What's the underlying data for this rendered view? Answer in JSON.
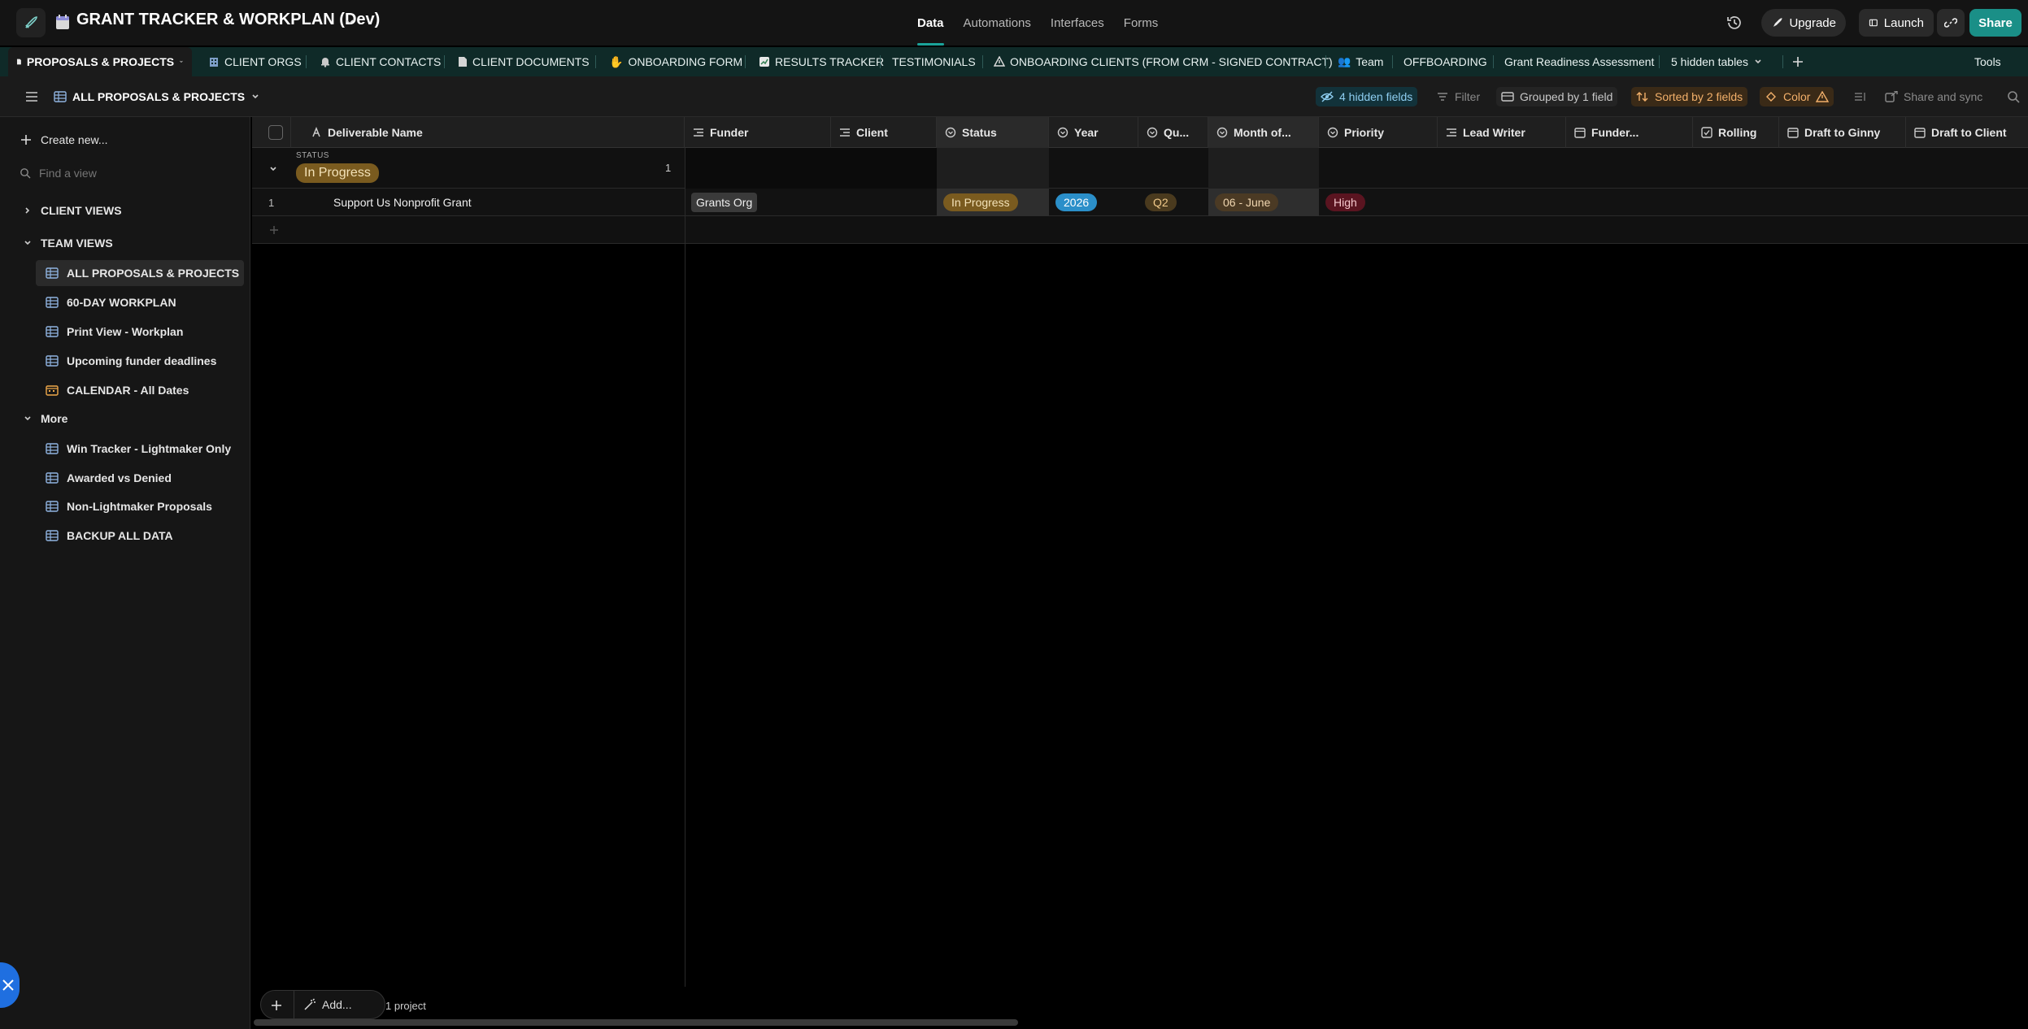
{
  "app": {
    "base_title": "GRANT TRACKER & WORKPLAN (Dev)",
    "nav": [
      {
        "label": "Data",
        "active": true
      },
      {
        "label": "Automations",
        "active": false
      },
      {
        "label": "Interfaces",
        "active": false
      },
      {
        "label": "Forms",
        "active": false
      }
    ],
    "actions": {
      "upgrade": "Upgrade",
      "launch": "Launch",
      "share": "Share"
    }
  },
  "tables": {
    "active": "PROPOSALS & PROJECTS",
    "items": [
      {
        "label": "CLIENT ORGS",
        "icon": "building-icon"
      },
      {
        "label": "CLIENT CONTACTS",
        "icon": "bell-icon"
      },
      {
        "label": "CLIENT DOCUMENTS",
        "icon": "document-icon"
      },
      {
        "label": "ONBOARDING FORM",
        "icon": "wave-hand-icon"
      },
      {
        "label": "RESULTS TRACKER",
        "icon": "chart-icon"
      },
      {
        "label": "TESTIMONIALS",
        "icon": ""
      },
      {
        "label": "ONBOARDING CLIENTS (FROM CRM - SIGNED CONTRACT)",
        "icon": "warning-icon"
      },
      {
        "label": "Team",
        "icon": "people-icon"
      },
      {
        "label": "OFFBOARDING",
        "icon": ""
      },
      {
        "label": "Grant Readiness Assessment",
        "icon": ""
      }
    ],
    "hidden": "5 hidden tables",
    "tools": "Tools"
  },
  "viewbar": {
    "view_name": "ALL PROPOSALS & PROJECTS",
    "hidden_fields": "4 hidden fields",
    "filter": "Filter",
    "grouped": "Grouped by 1 field",
    "sorted": "Sorted by 2 fields",
    "color": "Color",
    "share_sync": "Share and sync"
  },
  "sidebar": {
    "create_new": "Create new...",
    "find_view_placeholder": "Find a view",
    "sections": {
      "client_views": "CLIENT VIEWS",
      "team_views": "TEAM VIEWS",
      "more": "More"
    },
    "team_views": [
      {
        "label": "ALL PROPOSALS & PROJECTS",
        "icon": "grid-icon",
        "active": true
      },
      {
        "label": "60-DAY WORKPLAN",
        "icon": "grid-icon"
      },
      {
        "label": "Print View - Workplan",
        "icon": "grid-icon"
      },
      {
        "label": "Upcoming funder deadlines",
        "icon": "grid-icon"
      },
      {
        "label": "CALENDAR - All Dates",
        "icon": "calendar-icon"
      }
    ],
    "more_views": [
      {
        "label": "Win Tracker - Lightmaker Only",
        "icon": "grid-icon"
      },
      {
        "label": "Awarded vs Denied",
        "icon": "grid-icon"
      },
      {
        "label": "Non-Lightmaker Proposals",
        "icon": "grid-icon"
      },
      {
        "label": "BACKUP ALL DATA",
        "icon": "grid-icon"
      }
    ]
  },
  "grid": {
    "columns": [
      {
        "label": "Deliverable Name",
        "icon": "text-icon"
      },
      {
        "label": "Funder",
        "icon": "link-icon"
      },
      {
        "label": "Client",
        "icon": "link-icon"
      },
      {
        "label": "Status",
        "icon": "single-select-icon"
      },
      {
        "label": "Year",
        "icon": "single-select-icon"
      },
      {
        "label": "Qu...",
        "icon": "single-select-icon"
      },
      {
        "label": "Month of...",
        "icon": "single-select-icon"
      },
      {
        "label": "Priority",
        "icon": "single-select-icon"
      },
      {
        "label": "Lead Writer",
        "icon": "link-icon"
      },
      {
        "label": "Funder...",
        "icon": "date-icon"
      },
      {
        "label": "Rolling",
        "icon": "checkbox-icon"
      },
      {
        "label": "Draft to Ginny",
        "icon": "date-icon"
      },
      {
        "label": "Draft to Client",
        "icon": "date-icon"
      }
    ],
    "group": {
      "field_label": "STATUS",
      "value": "In Progress",
      "count": "1"
    },
    "rows": [
      {
        "num": "1",
        "deliverable": "Support Us Nonprofit Grant",
        "funder": "Grants Org",
        "status": "In Progress",
        "year": "2026",
        "quarter": "Q2",
        "month": "06 - June",
        "priority": "High"
      }
    ],
    "footer": {
      "add_label": "Add...",
      "record_count": "1 project"
    }
  }
}
